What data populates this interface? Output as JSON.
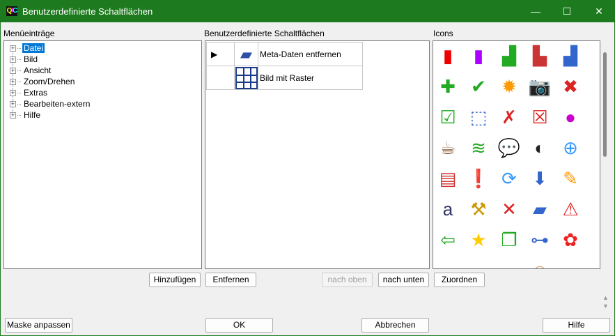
{
  "window": {
    "title": "Benutzerdefinierte Schaltflächen",
    "logo": "QIC",
    "minimize": "—",
    "maximize": "☐",
    "close": "✕"
  },
  "menu_panel": {
    "label": "Menüeinträge",
    "items": [
      "Datei",
      "Bild",
      "Ansicht",
      "Zoom/Drehen",
      "Extras",
      "Bearbeiten-extern",
      "Hilfe"
    ],
    "selected": "Datei"
  },
  "buttons_panel": {
    "label": "Benutzerdefinierte Schaltflächen",
    "rows": [
      {
        "icon": "eraser-icon",
        "label": "Meta-Daten entfernen",
        "current": true
      },
      {
        "icon": "grid-icon",
        "label": "Bild mit Raster",
        "current": false
      }
    ]
  },
  "icons_panel": {
    "label": "Icons",
    "icons": [
      {
        "name": "color-bars-icon",
        "g": "▮",
        "c": "#e00"
      },
      {
        "name": "rainbow-bars-icon",
        "g": "▮",
        "c": "#a0f"
      },
      {
        "name": "bar-chart-icon",
        "g": "▟",
        "c": "#2a2"
      },
      {
        "name": "3d-chart-icon",
        "g": "▙",
        "c": "#c33"
      },
      {
        "name": "column-chart-icon",
        "g": "▟",
        "c": "#36c"
      },
      {
        "name": "plus-icon",
        "g": "✚",
        "c": "#2a2"
      },
      {
        "name": "check-icon",
        "g": "✔",
        "c": "#2a2"
      },
      {
        "name": "sun-icon",
        "g": "✹",
        "c": "#f90"
      },
      {
        "name": "camera-icon",
        "g": "📷",
        "c": "#666"
      },
      {
        "name": "close-circle-icon",
        "g": "✖",
        "c": "#d22"
      },
      {
        "name": "checklist-icon",
        "g": "☑",
        "c": "#2a2"
      },
      {
        "name": "brush-select-icon",
        "g": "⬚",
        "c": "#36c"
      },
      {
        "name": "delete-page-icon",
        "g": "✗",
        "c": "#d22"
      },
      {
        "name": "close-box-icon",
        "g": "☒",
        "c": "#d22"
      },
      {
        "name": "color-circles-icon",
        "g": "●",
        "c": "#c0c"
      },
      {
        "name": "coffee-icon",
        "g": "☕",
        "c": "#853"
      },
      {
        "name": "layers-icon",
        "g": "≋",
        "c": "#2a2"
      },
      {
        "name": "speech-bubble-icon",
        "g": "💬",
        "c": "#39f"
      },
      {
        "name": "contrast-icon",
        "g": "◐",
        "c": "#222"
      },
      {
        "name": "zoom-plus-icon",
        "g": "⊕",
        "c": "#39f"
      },
      {
        "name": "document-icon",
        "g": "▤",
        "c": "#c33"
      },
      {
        "name": "warning-circle-icon",
        "g": "❗",
        "c": "#d22"
      },
      {
        "name": "refresh-icon",
        "g": "⟳",
        "c": "#39f"
      },
      {
        "name": "arrow-down-icon",
        "g": "⬇",
        "c": "#36c"
      },
      {
        "name": "edit-icon",
        "g": "✎",
        "c": "#f90"
      },
      {
        "name": "text-icon",
        "g": "a",
        "c": "#336"
      },
      {
        "name": "tools-icon",
        "g": "⚒",
        "c": "#c90"
      },
      {
        "name": "cross-icon",
        "g": "✕",
        "c": "#d22"
      },
      {
        "name": "eraser-icon",
        "g": "▰",
        "c": "#36c"
      },
      {
        "name": "warning-icon",
        "g": "⚠",
        "c": "#d22"
      },
      {
        "name": "import-icon",
        "g": "⇦",
        "c": "#2a2"
      },
      {
        "name": "star-icon",
        "g": "★",
        "c": "#fc0"
      },
      {
        "name": "copy-icon",
        "g": "❐",
        "c": "#2a2"
      },
      {
        "name": "network-icon",
        "g": "⊶",
        "c": "#36c"
      },
      {
        "name": "flower-icon",
        "g": "✿",
        "c": "#e22"
      },
      {
        "name": "window-icon",
        "g": "▭",
        "c": "#36c"
      },
      {
        "name": "bowl-icon",
        "g": "◡",
        "c": "#39f"
      },
      {
        "name": "image-icon",
        "g": "▬",
        "c": "#39f"
      },
      {
        "name": "person-icon",
        "g": "☺",
        "c": "#c96"
      },
      {
        "name": "table-icon",
        "g": "▭",
        "c": "#333"
      }
    ]
  },
  "actions": {
    "add": "Hinzufügen",
    "remove": "Entfernen",
    "up": "nach oben",
    "down": "nach unten",
    "assign": "Zuordnen",
    "adapt": "Maske anpassen",
    "ok": "OK",
    "cancel": "Abbrechen",
    "help": "Hilfe"
  }
}
